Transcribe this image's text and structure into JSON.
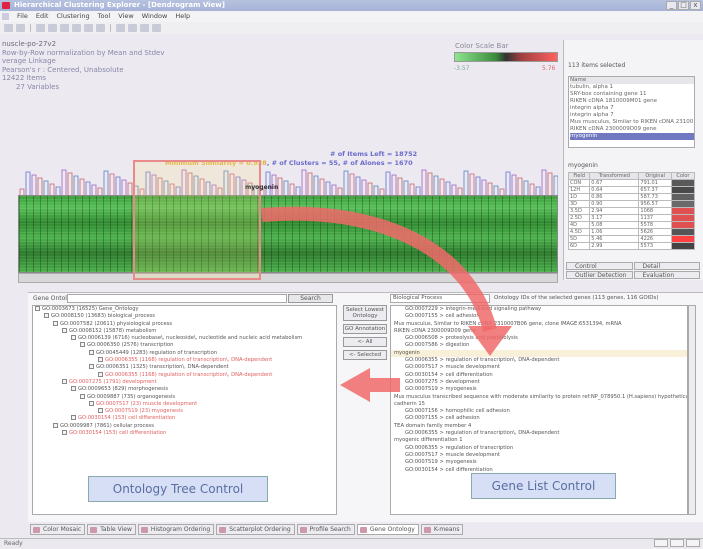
{
  "window": {
    "title": "Hierarchical Clustering Explorer - [Dendrogram View]",
    "controls": [
      "_",
      "□",
      "x"
    ]
  },
  "menu": [
    "File",
    "Edit",
    "Clustering",
    "Tool",
    "View",
    "Window",
    "Help"
  ],
  "info": {
    "line1": "nuscle-po-27v2",
    "line2": "Row-by-Row normalization by Mean and Stdev",
    "line3": "verage Linkage",
    "line4": "Pearson's r : Centered, Unabsolute",
    "line5": "12422 Items",
    "line6": "27 Variables"
  },
  "colorscale": {
    "label": "Color Scale Bar",
    "min": "-3.57",
    "max": "5.76",
    "low_color": "#8fe58f",
    "high_color": "#ff6060"
  },
  "stats": {
    "items_left": "# of Items Left = 18752",
    "min_similarity": "Minimum Similarity = 0.928",
    "clusters": "# of Clusters = 55",
    "alones": "# of Alones = 1670"
  },
  "heatmap": {
    "selected_gene": "myogenin"
  },
  "right_panel": {
    "items_selected": "113 items selected",
    "list_header": "Name",
    "list": [
      "tubulin, alpha 1",
      "SRY-box containing gene 11",
      "RIKEN cDNA 1810009M01 gene",
      "integrin alpha 7",
      "integrin alpha 7",
      "Mus musculus, Similar to RIKEN cDNA 23100",
      "RIKEN cDNA 2300009D09 gene",
      "myogenin"
    ],
    "selected_index": 7,
    "gene_label": "myogenin",
    "table_headers": [
      "Field",
      "Transformed",
      "Original",
      "Color"
    ],
    "table_rows": [
      [
        "CON",
        "0.67",
        "791.01"
      ],
      [
        "12H",
        "0.64",
        "657.37"
      ],
      [
        "1D",
        "0.86",
        "587.73"
      ],
      [
        "3D",
        "0.90",
        "956.57"
      ],
      [
        "3.5D",
        "2.94",
        "1068"
      ],
      [
        "2.5D",
        "3.17",
        "1137"
      ],
      [
        "4D",
        "5.08",
        "5578"
      ],
      [
        "4.5D",
        "1.06",
        "5626"
      ],
      [
        "5D",
        "5.46",
        "4226"
      ],
      [
        "6D",
        "2.99",
        "5573"
      ]
    ],
    "tabs": [
      "Control",
      "Detail",
      "Outlier Detection",
      "Evaluation"
    ]
  },
  "ontology": {
    "panel_label": "Gene Ontology",
    "search_button": "Search",
    "tree": [
      {
        "text": "GO:0003673 (16525) Gene_Ontology",
        "level": 0,
        "red": false
      },
      {
        "text": "GO:0008150 (13683) biological_process",
        "level": 1,
        "red": false
      },
      {
        "text": "GO:0007582 (20611) physiological process",
        "level": 2,
        "red": false
      },
      {
        "text": "GO:0008152 (15878) metabolism",
        "level": 3,
        "red": false
      },
      {
        "text": "GO:0006139 (6716) nucleobase\\, nucleoside\\, nucleotide and nucleic acid metabolism",
        "level": 4,
        "red": false
      },
      {
        "text": "GO:0006350 (2576) transcription",
        "level": 5,
        "red": false
      },
      {
        "text": "GO:0045449 (1283) regulation of transcription",
        "level": 6,
        "red": false
      },
      {
        "text": "GO:0006355 (1168) regulation of transcription\\, DNA-dependent",
        "level": 7,
        "red": true
      },
      {
        "text": "GO:0006351 (1325) transcription\\, DNA-dependent",
        "level": 6,
        "red": false
      },
      {
        "text": "GO:0006355 (1168) regulation of transcription\\, DNA-dependent",
        "level": 7,
        "red": true
      },
      {
        "text": "GO:0007275 (1791) development",
        "level": 3,
        "red": true
      },
      {
        "text": "GO:0009653 (829) morphogenesis",
        "level": 4,
        "red": false
      },
      {
        "text": "GO:0009887 (735) organogenesis",
        "level": 5,
        "red": false
      },
      {
        "text": "GO:0007517 (23) muscle development",
        "level": 6,
        "red": true
      },
      {
        "text": "GO:0007519 (23) myogenesis",
        "level": 7,
        "red": true
      },
      {
        "text": "GO:0030154 (153) cell differentiation",
        "level": 4,
        "red": true
      },
      {
        "text": "GO:0009987 (7861) cellular process",
        "level": 2,
        "red": false
      },
      {
        "text": "GO:0030154 (153) cell differentiation",
        "level": 3,
        "red": true
      }
    ],
    "buttons": [
      "Select Lowest Ontology",
      "GO Annotation",
      "<- All",
      "<- Selected"
    ]
  },
  "genelist": {
    "select_value": "Biological Process",
    "header": "Ontology IDs of the selected genes (113 genes, 116 GOIDs)",
    "rows": [
      {
        "text": "GO:0007229 > integrin-mediated signaling pathway",
        "sub": true
      },
      {
        "text": "GO:0007155 > cell adhesion",
        "sub": true
      },
      {
        "text": "Mus musculus, Similar to RIKEN cDNA 2310007B06 gene, clone IMAGE:6531394, mRNA",
        "sub": false
      },
      {
        "text": "RIKEN cDNA 2300009D09 gene",
        "sub": false
      },
      {
        "text": "GO:0006508 > proteolysis and peptidolysis",
        "sub": true
      },
      {
        "text": "GO:0007586 > digestion",
        "sub": true
      },
      {
        "text": "myogenin",
        "sub": false,
        "hl": true
      },
      {
        "text": "GO:0006355 > regulation of transcription\\, DNA-dependent",
        "sub": true
      },
      {
        "text": "GO:0007517 > muscle development",
        "sub": true
      },
      {
        "text": "GO:0030154 > cell differentiation",
        "sub": true
      },
      {
        "text": "GO:0007275 > development",
        "sub": true
      },
      {
        "text": "GO:0007519 > myogenesis",
        "sub": true
      },
      {
        "text": "Mus musculus transcribed sequence with moderate similarity to protein ref:NP_078950.1 (H.sapiens) hypothetical",
        "sub": false
      },
      {
        "text": "cadherin 15",
        "sub": false
      },
      {
        "text": "GO:0007156 > homophilic cell adhesion",
        "sub": true
      },
      {
        "text": "GO:0007155 > cell adhesion",
        "sub": true
      },
      {
        "text": "",
        "sub": false
      },
      {
        "text": "TEA domain family member 4",
        "sub": false
      },
      {
        "text": "GO:0006355 > regulation of transcription\\, DNA-dependent",
        "sub": true
      },
      {
        "text": "myogenic differentiation 1",
        "sub": false
      },
      {
        "text": "GO:0006355 > regulation of transcription",
        "sub": true
      },
      {
        "text": "GO:0007517 > muscle development",
        "sub": true
      },
      {
        "text": "GO:0007519 > myogenesis",
        "sub": true
      },
      {
        "text": "GO:0030154 > cell differentiation",
        "sub": true
      }
    ]
  },
  "callouts": {
    "tree": "Ontology Tree Control",
    "gene": "Gene List Control"
  },
  "bottom_tabs": [
    "Color Mosaic",
    "Table View",
    "Histogram Ordering",
    "Scatterplot Ordering",
    "Profile Search",
    "Gene Ontology",
    "K-means"
  ],
  "active_tab_index": 5,
  "status": "Ready",
  "arrow_color": "#f06a6a"
}
